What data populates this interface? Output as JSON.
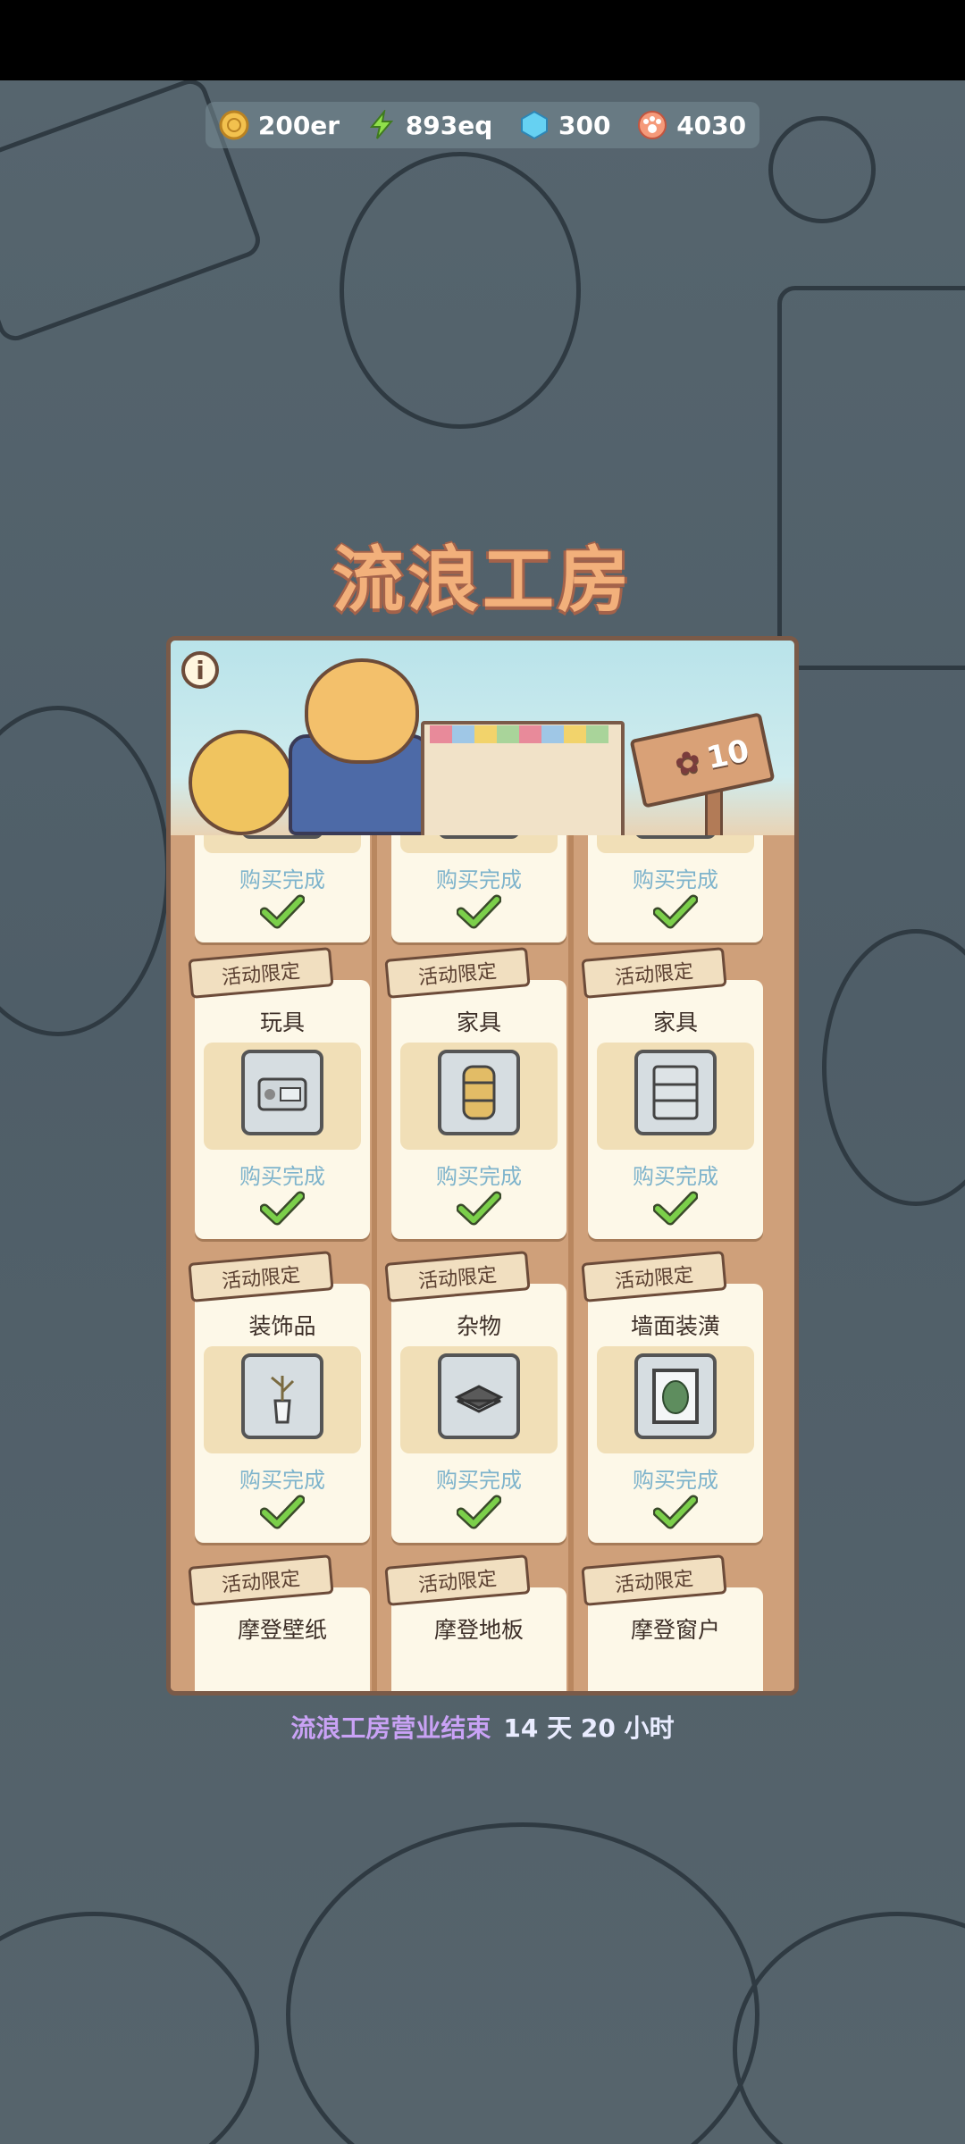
{
  "resources": [
    {
      "name": "coin",
      "icon": "coin-icon",
      "value": "200er",
      "color": "#f2c14e"
    },
    {
      "name": "energy",
      "icon": "lightning-icon",
      "value": "893eq",
      "color": "#8fe04a"
    },
    {
      "name": "gem",
      "icon": "gem-icon",
      "value": "300",
      "color": "#66d1f2"
    },
    {
      "name": "paw",
      "icon": "paw-icon",
      "value": "4030",
      "color": "#f59a7a"
    }
  ],
  "title": "流浪工房",
  "banner": {
    "level": "10",
    "info_icon": "i"
  },
  "items": [
    {
      "tag": "",
      "category": "",
      "status": "购买完成"
    },
    {
      "tag": "",
      "category": "",
      "status": "购买完成"
    },
    {
      "tag": "",
      "category": "",
      "status": "购买完成"
    },
    {
      "tag": "活动限定",
      "category": "玩具",
      "status": "购买完成",
      "icon": "radio-icon"
    },
    {
      "tag": "活动限定",
      "category": "家具",
      "status": "购买完成",
      "icon": "barrel-icon"
    },
    {
      "tag": "活动限定",
      "category": "家具",
      "status": "购买完成",
      "icon": "shelf-icon"
    },
    {
      "tag": "活动限定",
      "category": "装饰品",
      "status": "购买完成",
      "icon": "vase-icon"
    },
    {
      "tag": "活动限定",
      "category": "杂物",
      "status": "购买完成",
      "icon": "book-icon"
    },
    {
      "tag": "活动限定",
      "category": "墙面装潢",
      "status": "购买完成",
      "icon": "leaf-frame-icon"
    },
    {
      "tag": "活动限定",
      "category": "摩登壁纸"
    },
    {
      "tag": "活动限定",
      "category": "摩登地板"
    },
    {
      "tag": "活动限定",
      "category": "摩登窗户"
    }
  ],
  "footer": {
    "label": "流浪工房营业结束",
    "time": "14 天 20 小时"
  },
  "colors": {
    "accent_title": "#f2b07b",
    "done": "#7fb4cc",
    "check": "#7bcf4a",
    "footer_label": "#c9a2f5"
  }
}
